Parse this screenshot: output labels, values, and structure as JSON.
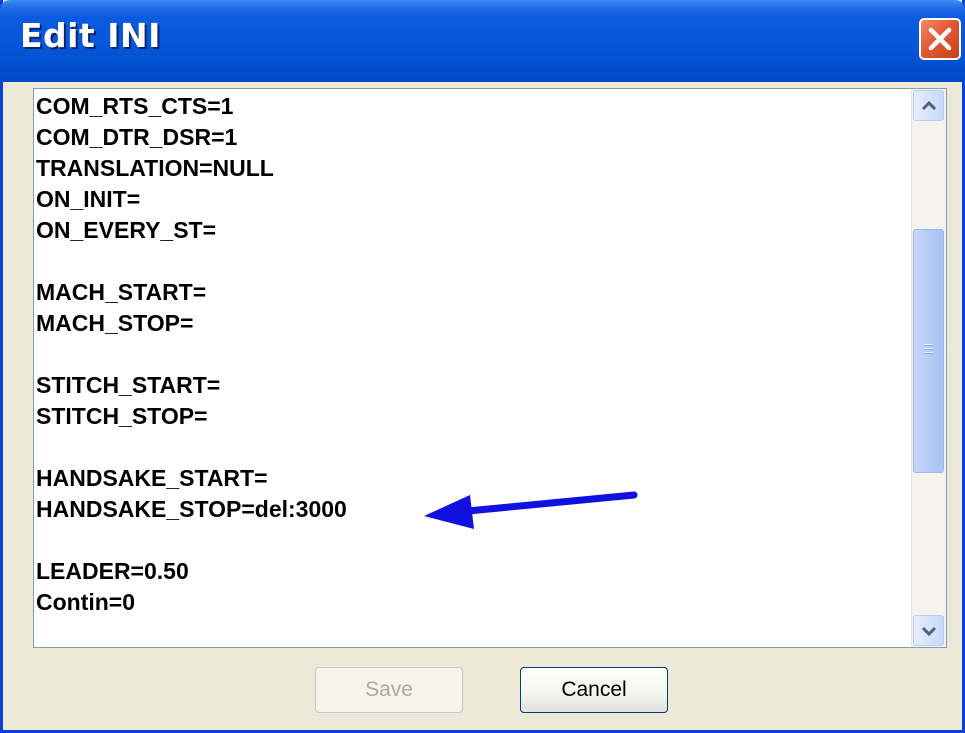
{
  "window": {
    "title": "Edit INI"
  },
  "editor": {
    "lines": [
      "COM_RTS_CTS=1",
      "COM_DTR_DSR=1",
      "TRANSLATION=NULL",
      "ON_INIT=",
      "ON_EVERY_ST=",
      "",
      "MACH_START=",
      "MACH_STOP=",
      "",
      "STITCH_START=",
      "STITCH_STOP=",
      "",
      "HANDSAKE_START=",
      "HANDSAKE_STOP=del:3000",
      "",
      "LEADER=0.50",
      "Contin=0"
    ]
  },
  "buttons": {
    "save_label": "Save",
    "save_enabled": false,
    "cancel_label": "Cancel"
  },
  "annotation": {
    "arrow_color": "#1010E0",
    "points_to": "HANDSAKE_STOP=del:3000"
  },
  "colors": {
    "titlebar": "#0657DB",
    "close_button": "#E25A35",
    "dialog_bg": "#ECE9D8"
  }
}
